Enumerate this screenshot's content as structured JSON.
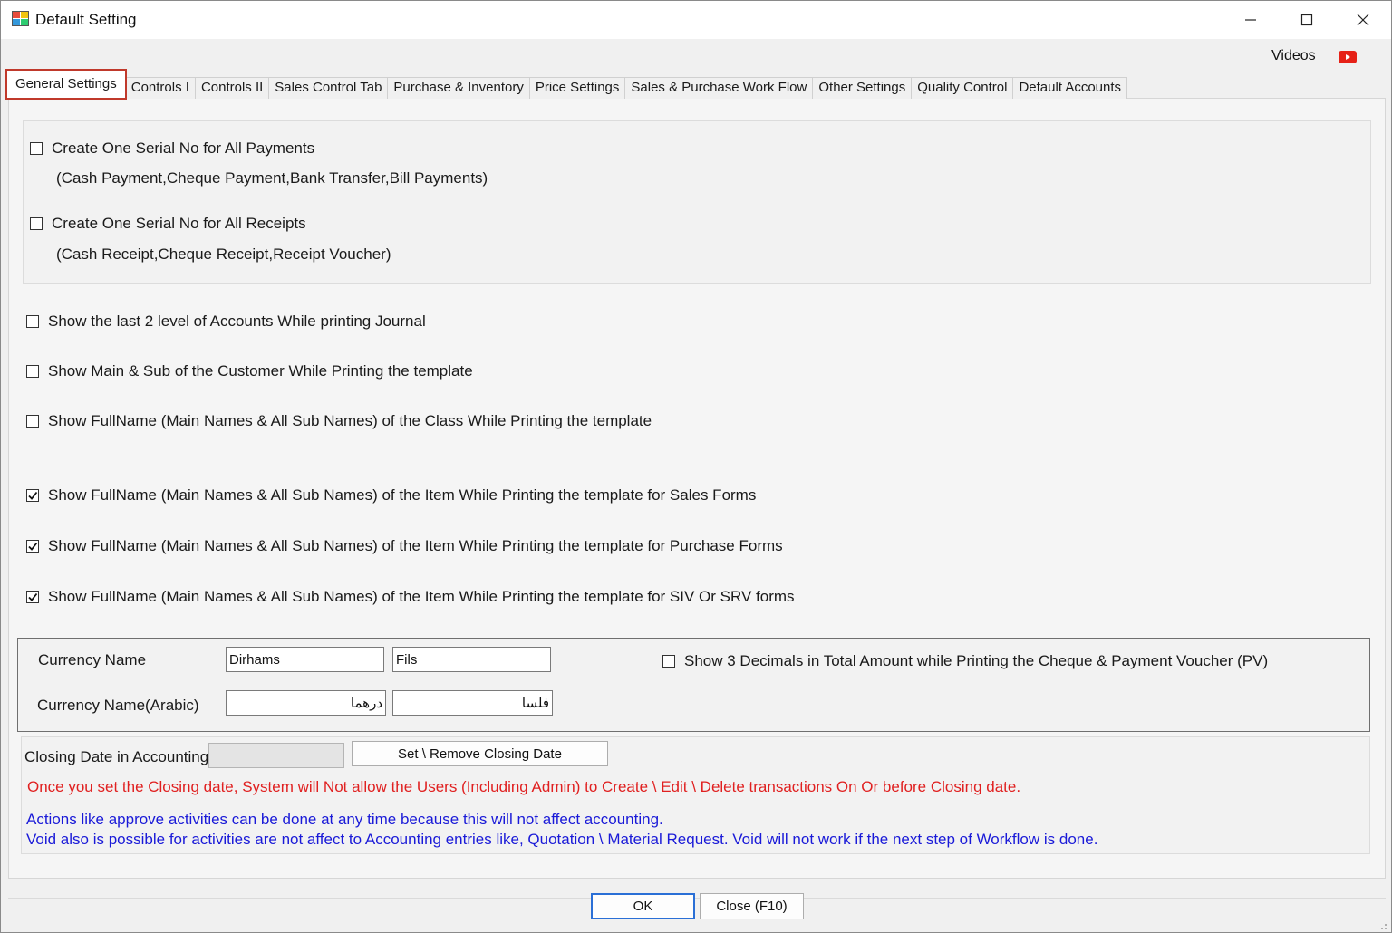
{
  "window": {
    "title": "Default Setting"
  },
  "header": {
    "videos_label": "Videos",
    "youtube_color": "#e62117"
  },
  "tabs": [
    {
      "label": "General Settings",
      "active": true
    },
    {
      "label": "Controls I"
    },
    {
      "label": "Controls II"
    },
    {
      "label": "Sales Control Tab"
    },
    {
      "label": "Purchase & Inventory"
    },
    {
      "label": "Price Settings"
    },
    {
      "label": "Sales & Purchase Work Flow"
    },
    {
      "label": "Other Settings"
    },
    {
      "label": "Quality Control"
    },
    {
      "label": "Default Accounts"
    }
  ],
  "serial_group": {
    "payments_label": "Create One Serial No for All Payments",
    "payments_checked": false,
    "payments_sub": "(Cash Payment,Cheque Payment,Bank Transfer,Bill Payments)",
    "receipts_label": "Create One Serial No for All Receipts",
    "receipts_checked": false,
    "receipts_sub": "(Cash Receipt,Cheque Receipt,Receipt Voucher)"
  },
  "options": [
    {
      "label": "Show the last 2 level of Accounts While printing Journal",
      "checked": false
    },
    {
      "label": "Show Main & Sub of the Customer While Printing the template",
      "checked": false
    },
    {
      "label": "Show FullName (Main Names & All Sub Names) of the Class While Printing the template",
      "checked": false
    },
    {
      "label": "Show FullName (Main Names & All Sub Names) of the Item While Printing the template for Sales Forms",
      "checked": true
    },
    {
      "label": "Show FullName (Main Names & All Sub Names) of the Item While Printing the template for Purchase Forms",
      "checked": true
    },
    {
      "label": "Show FullName (Main Names & All Sub Names) of the Item While Printing the template for SIV Or SRV forms",
      "checked": true
    }
  ],
  "currency": {
    "name_label": "Currency Name",
    "name_main": "Dirhams",
    "name_sub": "Fils",
    "arabic_label": "Currency Name(Arabic)",
    "arabic_main": "درهما",
    "arabic_sub": "فلسا",
    "decimals_label": "Show 3 Decimals in Total Amount while Printing the Cheque & Payment Voucher (PV)",
    "decimals_checked": false
  },
  "closing": {
    "label": "Closing Date in Accounting",
    "date_value": "",
    "button_label": "Set \\ Remove Closing Date",
    "warning": "Once you set the Closing date, System will Not allow the Users (Including Admin)  to Create \\ Edit \\ Delete transactions On Or before Closing date.",
    "info_line1": "Actions like approve activities can be done at any time because this will not affect accounting.",
    "info_line2": "Void also is possible for activities are not affect to Accounting entries like, Quotation \\ Material Request. Void will not work if the next step of Workflow is done."
  },
  "footer": {
    "ok_label": "OK",
    "close_label": "Close (F10)"
  }
}
